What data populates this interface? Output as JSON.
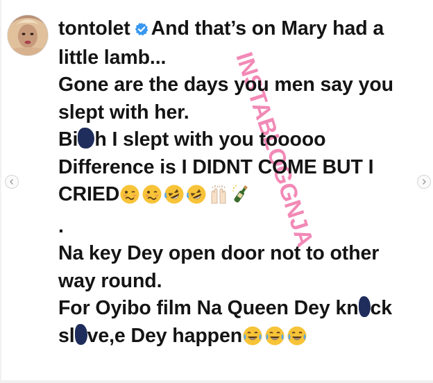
{
  "post": {
    "username": "tontolet",
    "text_1": "And that’s on Mary had a",
    "text_2": "little lamb...",
    "text_3": "Gone are the days you men say you",
    "text_4": "slept with her.",
    "text_5a": "Bi",
    "text_5b": "h I slept with you tooooo",
    "text_6": "Difference is I DIDNT COME BUT I",
    "text_7": "CRIED",
    "text_8": ".",
    "text_9": "Na key Dey open door not to other",
    "text_10": "way round.",
    "text_11a": "For Oyibo film Na Queen Dey kn",
    "text_11b": "ck",
    "text_12a": "sl",
    "text_12b": "ve,e Dey happen"
  },
  "watermark": {
    "text": "INSTABLOGGNJA"
  },
  "icons": {
    "verified": "verified-badge-icon",
    "blot": "ink-blot-censor-icon",
    "emoji_woozy": "woozy-face-icon",
    "emoji_rofl": "rolling-on-floor-laughing-icon",
    "emoji_hands": "raising-hands-icon",
    "emoji_bottle": "bottle-popping-cork-icon",
    "emoji_joy": "face-with-tears-of-joy-icon",
    "nav_left": "chevron-left-icon",
    "nav_right": "chevron-right-icon"
  },
  "colors": {
    "text": "#141414",
    "verified": "#3897f0",
    "watermark": "#e8287a",
    "blot": "#1f2d5c",
    "emoji_yellow": "#f7c338"
  }
}
